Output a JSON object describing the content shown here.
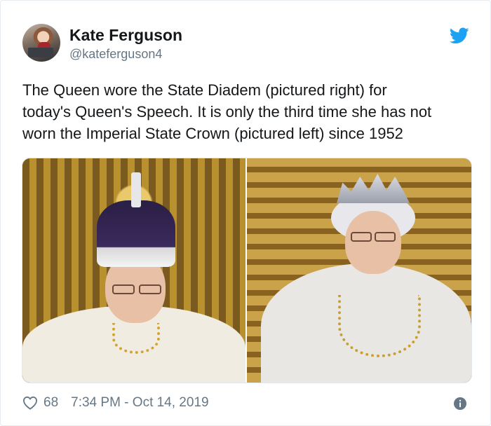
{
  "user": {
    "name": "Kate Ferguson",
    "handle": "@kateferguson4"
  },
  "tweet": {
    "text": "The Queen wore the State Diadem (pictured right) for\ntoday's Queen's Speech. It is only the third time she has not\nworn the Imperial State Crown (pictured left) since 1952"
  },
  "footer": {
    "likes": "68",
    "timestamp": "7:34 PM - Oct 14, 2019"
  },
  "icons": {
    "brand": "twitter-bird-icon",
    "like": "heart-icon",
    "info": "info-icon"
  },
  "colors": {
    "twitter_blue": "#1da1f2",
    "text_primary": "#14171a",
    "text_secondary": "#657786",
    "border": "#e6ecf0"
  }
}
